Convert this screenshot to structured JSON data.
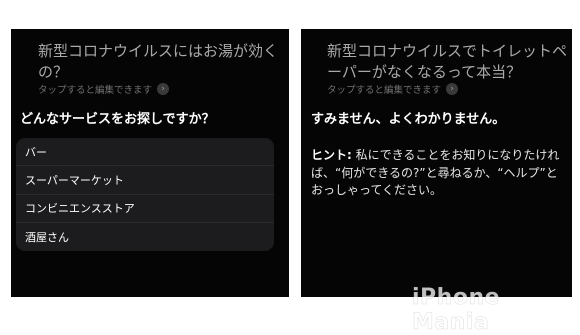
{
  "left": {
    "query": "新型コロナウイルスにはお湯が効くの？",
    "edit_hint": "タップすると編集できます",
    "answer": "どんなサービスをお探しですか？",
    "options": [
      "バー",
      "スーパーマーケット",
      "コンビニエンスストア",
      "酒屋さん"
    ]
  },
  "right": {
    "query": "新型コロナウイルスでトイレットペーパーがなくなるって本当？",
    "edit_hint": "タップすると編集できます",
    "answer": "すみません、よくわかりません。",
    "help_label": "ヒント:",
    "help_text": " 私にできることをお知りになりたければ、“何ができるの?”と尋ねるか、“ヘルプ”とおっしゃってください。"
  },
  "watermark": "iPhone Mania",
  "colors": {
    "panel_bg": "#050505",
    "option_bg": "#1c1c1e",
    "query_text": "#a9a9a9"
  },
  "icons": {
    "edit_hint": "chevron-right-icon"
  }
}
